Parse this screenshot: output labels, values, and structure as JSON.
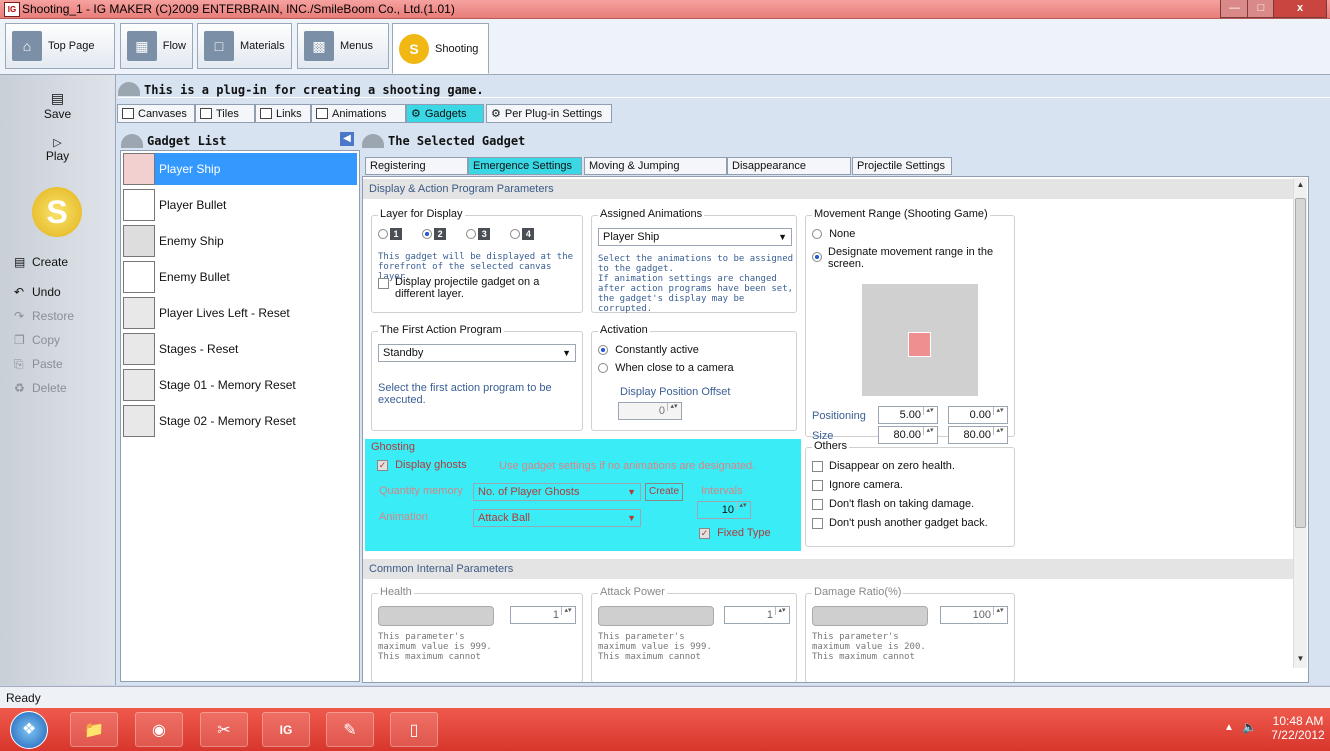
{
  "window": {
    "title": "Shooting_1 - IG MAKER (C)2009 ENTERBRAIN, INC./SmileBoom Co., Ltd.(1.01)",
    "app_icon": "IG"
  },
  "top_tabs": [
    "Top Page",
    "Flow",
    "Materials",
    "Menus",
    "Shooting"
  ],
  "plugin_banner": "This is a plug-in for creating a shooting game.",
  "left_toolbar": {
    "save": "Save",
    "play": "Play",
    "create": "Create",
    "undo": "Undo",
    "restore": "Restore",
    "copy": "Copy",
    "paste": "Paste",
    "delete": "Delete"
  },
  "sub_tabs": [
    "Canvases",
    "Tiles",
    "Links",
    "Animations",
    "Gadgets",
    "Per Plug-in Settings"
  ],
  "gadget_list": {
    "title": "Gadget List",
    "items": [
      "Player Ship",
      "Player Bullet",
      "Enemy Ship",
      "Enemy Bullet",
      "Player Lives Left - Reset",
      "Stages - Reset",
      "Stage 01 - Memory Reset",
      "Stage 02 - Memory Reset"
    ]
  },
  "selected_gadget": {
    "title": "The Selected Gadget",
    "tabs": [
      "Registering Actions",
      "Emergence Settings",
      "Moving & Jumping Settings",
      "Disappearance Settings",
      "Projectile Settings"
    ]
  },
  "display_section": {
    "header": "Display & Action Program Parameters",
    "layer": {
      "title": "Layer for Display",
      "options": [
        "1",
        "2",
        "3",
        "4"
      ],
      "note": "This gadget will be displayed at the forefront of the selected canvas layer.",
      "projectile_label": "Display projectile gadget on a different layer."
    },
    "animations": {
      "title": "Assigned Animations",
      "value": "Player Ship",
      "note1": "Select the animations to be assigned to the gadget.",
      "note2": "If animation settings are changed after action programs have been set, the gadget's display may be corrupted."
    },
    "movement": {
      "title": "Movement Range (Shooting Game)",
      "none_label": "None",
      "designate_label": "Designate movement range in the screen.",
      "positioning_label": "Positioning",
      "pos_x": "5.00",
      "pos_y": "0.00",
      "size_label": "Size",
      "size_w": "80.00",
      "size_h": "80.00"
    },
    "first_action": {
      "title": "The First Action Program",
      "value": "Standby",
      "note": "Select the first action program to be executed."
    },
    "activation": {
      "title": "Activation",
      "constant_label": "Constantly active",
      "camera_label": "When close to a camera",
      "offset_label": "Display Position Offset",
      "offset_value": "0"
    },
    "ghosting": {
      "title": "Ghosting",
      "display_label": "Display ghosts",
      "hint": "Use gadget settings if no animations are designated.",
      "quantity_label": "Quantity memory",
      "quantity_value": "No. of Player Ghosts",
      "create_label": "Create",
      "intervals_label": "Intervals",
      "intervals_value": "10",
      "animation_label": "Animation",
      "animation_value": "Attack Ball",
      "fixed_label": "Fixed Type"
    },
    "others": {
      "title": "Others",
      "items": [
        "Disappear on zero health.",
        "Ignore camera.",
        "Don't flash on taking damage.",
        "Don't push another gadget back."
      ]
    }
  },
  "common_section": {
    "header": "Common Internal Parameters",
    "health": {
      "title": "Health",
      "value": "1",
      "note": "This parameter's maximum value is 999. This maximum cannot"
    },
    "attack": {
      "title": "Attack Power",
      "value": "1",
      "note": "This parameter's maximum value is 999. This maximum cannot"
    },
    "damage": {
      "title": "Damage Ratio(%)",
      "value": "100",
      "note": "This parameter's maximum value is 200. This maximum cannot"
    }
  },
  "status_bar": {
    "text": "Ready"
  },
  "taskbar": {
    "time": "10:48 AM",
    "date": "7/22/2012"
  },
  "colors": {
    "accent_cyan": "#39d8e4",
    "selection_blue": "#3399ff",
    "taskbar_red": "#d8362c"
  }
}
